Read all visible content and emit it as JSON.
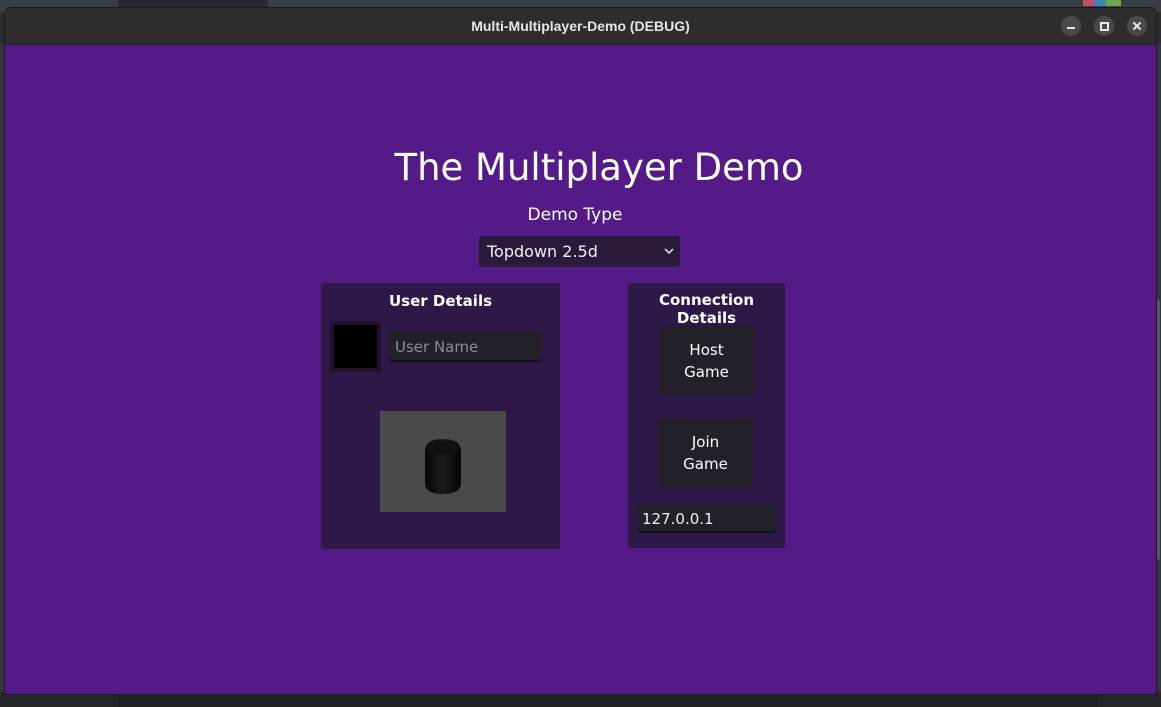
{
  "window": {
    "title": "Multi-Multiplayer-Demo (DEBUG)"
  },
  "main": {
    "heading": "The Multiplayer Demo",
    "demo_type_label": "Demo Type",
    "demo_type_selected": "Topdown 2.5d"
  },
  "user_details": {
    "title": "User Details",
    "color_swatch": "#000000",
    "username_value": "",
    "username_placeholder": "User Name"
  },
  "connection_details": {
    "title": "Connection Details",
    "host_label": "Host\nGame",
    "join_label": "Join\nGame",
    "ip_value": "127.0.0.1"
  },
  "colors": {
    "background": "#541a87",
    "panel": "#2e1848",
    "titlebar": "#2d2d2d"
  },
  "icons": {
    "dropdown": "chevron-down-icon",
    "minimize": "minimize-icon",
    "maximize": "maximize-icon",
    "close": "close-icon"
  }
}
